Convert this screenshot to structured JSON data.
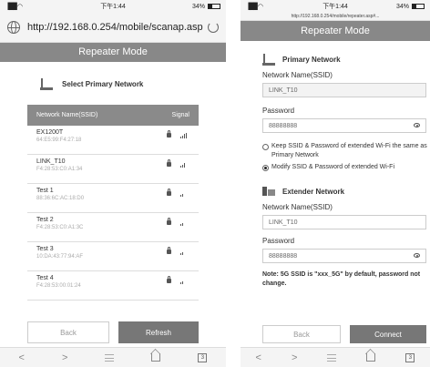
{
  "left": {
    "status": {
      "signal": "▐██ ◠",
      "time": "下午1:44",
      "battery": "34%",
      "battery_level": 0.34
    },
    "url": "http://192.168.0.254/mobile/scanap.asp",
    "title": "Repeater Mode",
    "section_title": "Select Primary Network",
    "table_headers": {
      "ssid": "Network Name(SSID)",
      "signal": "Signal"
    },
    "networks": [
      {
        "ssid": "EX1200T",
        "mac": "64:E5:99:F4:27:18",
        "bars": 4
      },
      {
        "ssid": "LINK_T10",
        "mac": "F4:28:53:C0:A1:34",
        "bars": 3
      },
      {
        "ssid": "Test 1",
        "mac": "88:36:6C:AC:18:D0",
        "bars": 2
      },
      {
        "ssid": "Test 2",
        "mac": "F4:28:53:C0:A1:3C",
        "bars": 2
      },
      {
        "ssid": "Test 3",
        "mac": "10:DA:43:77:94:AF",
        "bars": 2
      },
      {
        "ssid": "Test 4",
        "mac": "F4:28:53:00:01:24",
        "bars": 2
      }
    ],
    "buttons": {
      "back": "Back",
      "refresh": "Refresh"
    },
    "nav": {
      "back": "<",
      "forward": ">",
      "tabs": "3"
    }
  },
  "right": {
    "status": {
      "signal": "▐██ ◠",
      "time": "下午1:44",
      "battery": "34%"
    },
    "url": "http://192.168.0.254/mobile/repeater.asp#...",
    "title": "Repeater Mode",
    "primary_section": "Primary Network",
    "primary_ssid_label": "Network Name(SSID)",
    "primary_ssid_value": "LINK_T10",
    "primary_pw_label": "Password",
    "primary_pw_value": "88888888",
    "radio1": "Keep SSID & Password of extended Wi-Fi the same as Primary Network",
    "radio2": "Modify SSID & Password of extended Wi-Fi",
    "extender_section": "Extender Network",
    "ext_ssid_label": "Network Name(SSID)",
    "ext_ssid_value": "LINK_T10",
    "ext_pw_label": "Password",
    "ext_pw_value": "88888888",
    "note": "Note: 5G SSID is \"xxx_5G\" by default, password not change.",
    "buttons": {
      "back": "Back",
      "connect": "Connect"
    },
    "nav": {
      "back": "<",
      "forward": ">",
      "tabs": "3"
    }
  }
}
